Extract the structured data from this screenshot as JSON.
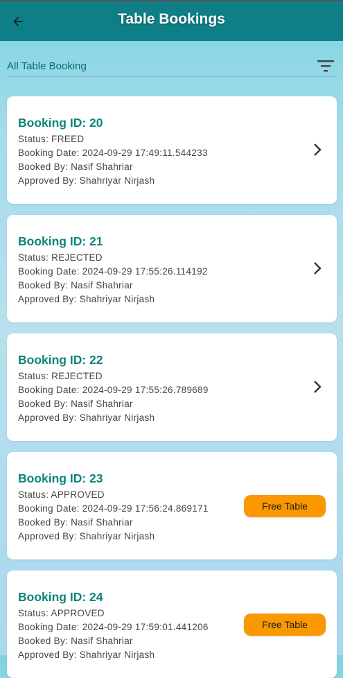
{
  "app_bar": {
    "title": "Table Bookings",
    "back_icon": "arrow-back-icon",
    "bg_color": "#0e7f86"
  },
  "filter": {
    "label": "All Table Booking",
    "icon": "filter-icon"
  },
  "bookings": [
    {
      "title": "Booking ID: 20",
      "status": "Status: FREED",
      "date": "Booking Date: 2024-09-29 17:49:11.544233",
      "booked_by": "Booked By: Nasif Shahriar",
      "approved_by": "Approved By: Shahriyar Nirjash",
      "action": "chevron-right-icon"
    },
    {
      "title": "Booking ID: 21",
      "status": "Status: REJECTED",
      "date": "Booking Date: 2024-09-29 17:55:26.114192",
      "booked_by": "Booked By: Nasif Shahriar",
      "approved_by": "Approved By: Shahriyar Nirjash",
      "action": "chevron-right-icon"
    },
    {
      "title": "Booking ID: 22",
      "status": "Status: REJECTED",
      "date": "Booking Date: 2024-09-29 17:55:26.789689",
      "booked_by": "Booked By: Nasif Shahriar",
      "approved_by": "Approved By: Shahriyar Nirjash",
      "action": "chevron-right-icon"
    },
    {
      "title": "Booking ID: 23",
      "status": "Status: APPROVED",
      "date": "Booking Date: 2024-09-29 17:56:24.869171",
      "booked_by": "Booked By: Nasif Shahriar",
      "approved_by": "Approved By: Shahriyar Nirjash",
      "action_label": "Free Table"
    },
    {
      "title": "Booking ID: 24",
      "status": "Status: APPROVED",
      "date": "Booking Date: 2024-09-29 17:59:01.441206",
      "booked_by": "Booked By: Nasif Shahriar",
      "approved_by": "Approved By: Shahriyar Nirjash",
      "action_label": "Free Table"
    }
  ],
  "colors": {
    "title_teal": "#0b8579",
    "free_button": "#f99800"
  }
}
